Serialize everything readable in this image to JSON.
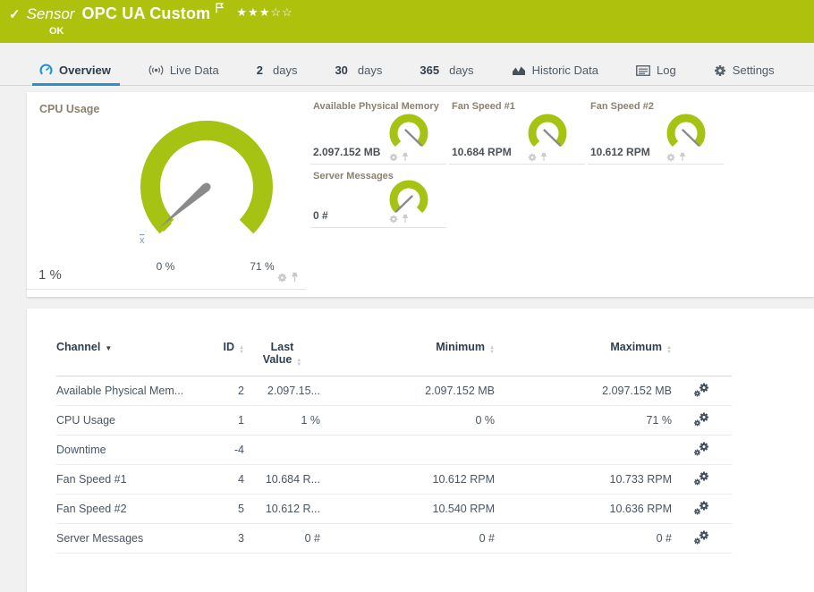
{
  "header": {
    "status_check_icon": "✓",
    "object_type": "Sensor",
    "title": "OPC UA Custom",
    "status": "OK",
    "rating": {
      "filled_str": "★★★",
      "empty_str": "☆☆",
      "filled": 3,
      "total": 5
    }
  },
  "tabs": [
    {
      "label": "Overview",
      "active": true
    },
    {
      "label": "Live Data"
    },
    {
      "num": "2",
      "unit": "days"
    },
    {
      "num": "30",
      "unit": "days"
    },
    {
      "num": "365",
      "unit": "days"
    },
    {
      "label": "Historic Data"
    },
    {
      "label": "Log"
    },
    {
      "label": "Settings"
    }
  ],
  "gauges": {
    "cpu": {
      "title": "CPU Usage",
      "value": "1 %",
      "scale_min": "0 %",
      "scale_max": "71 %",
      "avg_marker": "x",
      "value_num": 1,
      "min_num": 0,
      "max_num": 71
    },
    "tiles": [
      {
        "title": "Available Physical Memory",
        "value": "2.097.152 MB",
        "needle": "high"
      },
      {
        "title": "Fan Speed #1",
        "value": "10.684 RPM",
        "needle": "high"
      },
      {
        "title": "Fan Speed #2",
        "value": "10.612 RPM",
        "needle": "high"
      },
      {
        "title": "Server Messages",
        "value": "0 #",
        "needle": "low"
      }
    ]
  },
  "table": {
    "columns": {
      "channel": "Channel",
      "id": "ID",
      "last": "Last Value",
      "min": "Minimum",
      "max": "Maximum"
    },
    "rows": [
      {
        "channel": "Available Physical Mem...",
        "id": "2",
        "last": "2.097.15...",
        "min": "2.097.152 MB",
        "max": "2.097.152 MB"
      },
      {
        "channel": "CPU Usage",
        "id": "1",
        "last": "1 %",
        "min": "0 %",
        "max": "71 %"
      },
      {
        "channel": "Downtime",
        "id": "-4",
        "last": "",
        "min": "",
        "max": ""
      },
      {
        "channel": "Fan Speed #1",
        "id": "4",
        "last": "10.684 R...",
        "min": "10.612 RPM",
        "max": "10.733 RPM"
      },
      {
        "channel": "Fan Speed #2",
        "id": "5",
        "last": "10.612 R...",
        "min": "10.540 RPM",
        "max": "10.636 RPM"
      },
      {
        "channel": "Server Messages",
        "id": "3",
        "last": "0 #",
        "min": "0 #",
        "max": "0 #"
      }
    ]
  },
  "icons": {
    "sort_up": "▲",
    "sort_down": "▼",
    "sort_desc": "▼"
  },
  "colors": {
    "brand_green": "#aec10d",
    "gauge_green": "#a6c313",
    "needle_gray": "#8a8a8a",
    "accent_blue": "#2592cf",
    "text_dark": "#4a5562",
    "tile_title": "#8b8171"
  }
}
